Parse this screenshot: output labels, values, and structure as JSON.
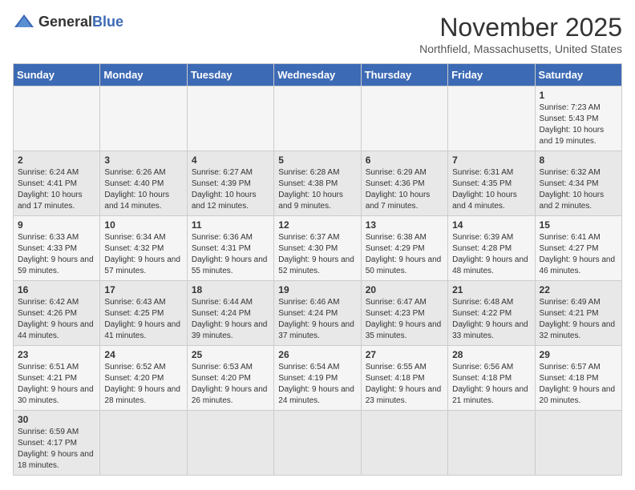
{
  "header": {
    "logo_general": "General",
    "logo_blue": "Blue",
    "month_year": "November 2025",
    "location": "Northfield, Massachusetts, United States"
  },
  "weekdays": [
    "Sunday",
    "Monday",
    "Tuesday",
    "Wednesday",
    "Thursday",
    "Friday",
    "Saturday"
  ],
  "weeks": [
    [
      {
        "day": "",
        "info": ""
      },
      {
        "day": "",
        "info": ""
      },
      {
        "day": "",
        "info": ""
      },
      {
        "day": "",
        "info": ""
      },
      {
        "day": "",
        "info": ""
      },
      {
        "day": "",
        "info": ""
      },
      {
        "day": "1",
        "info": "Sunrise: 7:23 AM\nSunset: 5:43 PM\nDaylight: 10 hours and 19 minutes."
      }
    ],
    [
      {
        "day": "2",
        "info": "Sunrise: 6:24 AM\nSunset: 4:41 PM\nDaylight: 10 hours and 17 minutes."
      },
      {
        "day": "3",
        "info": "Sunrise: 6:26 AM\nSunset: 4:40 PM\nDaylight: 10 hours and 14 minutes."
      },
      {
        "day": "4",
        "info": "Sunrise: 6:27 AM\nSunset: 4:39 PM\nDaylight: 10 hours and 12 minutes."
      },
      {
        "day": "5",
        "info": "Sunrise: 6:28 AM\nSunset: 4:38 PM\nDaylight: 10 hours and 9 minutes."
      },
      {
        "day": "6",
        "info": "Sunrise: 6:29 AM\nSunset: 4:36 PM\nDaylight: 10 hours and 7 minutes."
      },
      {
        "day": "7",
        "info": "Sunrise: 6:31 AM\nSunset: 4:35 PM\nDaylight: 10 hours and 4 minutes."
      },
      {
        "day": "8",
        "info": "Sunrise: 6:32 AM\nSunset: 4:34 PM\nDaylight: 10 hours and 2 minutes."
      }
    ],
    [
      {
        "day": "9",
        "info": "Sunrise: 6:33 AM\nSunset: 4:33 PM\nDaylight: 9 hours and 59 minutes."
      },
      {
        "day": "10",
        "info": "Sunrise: 6:34 AM\nSunset: 4:32 PM\nDaylight: 9 hours and 57 minutes."
      },
      {
        "day": "11",
        "info": "Sunrise: 6:36 AM\nSunset: 4:31 PM\nDaylight: 9 hours and 55 minutes."
      },
      {
        "day": "12",
        "info": "Sunrise: 6:37 AM\nSunset: 4:30 PM\nDaylight: 9 hours and 52 minutes."
      },
      {
        "day": "13",
        "info": "Sunrise: 6:38 AM\nSunset: 4:29 PM\nDaylight: 9 hours and 50 minutes."
      },
      {
        "day": "14",
        "info": "Sunrise: 6:39 AM\nSunset: 4:28 PM\nDaylight: 9 hours and 48 minutes."
      },
      {
        "day": "15",
        "info": "Sunrise: 6:41 AM\nSunset: 4:27 PM\nDaylight: 9 hours and 46 minutes."
      }
    ],
    [
      {
        "day": "16",
        "info": "Sunrise: 6:42 AM\nSunset: 4:26 PM\nDaylight: 9 hours and 44 minutes."
      },
      {
        "day": "17",
        "info": "Sunrise: 6:43 AM\nSunset: 4:25 PM\nDaylight: 9 hours and 41 minutes."
      },
      {
        "day": "18",
        "info": "Sunrise: 6:44 AM\nSunset: 4:24 PM\nDaylight: 9 hours and 39 minutes."
      },
      {
        "day": "19",
        "info": "Sunrise: 6:46 AM\nSunset: 4:24 PM\nDaylight: 9 hours and 37 minutes."
      },
      {
        "day": "20",
        "info": "Sunrise: 6:47 AM\nSunset: 4:23 PM\nDaylight: 9 hours and 35 minutes."
      },
      {
        "day": "21",
        "info": "Sunrise: 6:48 AM\nSunset: 4:22 PM\nDaylight: 9 hours and 33 minutes."
      },
      {
        "day": "22",
        "info": "Sunrise: 6:49 AM\nSunset: 4:21 PM\nDaylight: 9 hours and 32 minutes."
      }
    ],
    [
      {
        "day": "23",
        "info": "Sunrise: 6:51 AM\nSunset: 4:21 PM\nDaylight: 9 hours and 30 minutes."
      },
      {
        "day": "24",
        "info": "Sunrise: 6:52 AM\nSunset: 4:20 PM\nDaylight: 9 hours and 28 minutes."
      },
      {
        "day": "25",
        "info": "Sunrise: 6:53 AM\nSunset: 4:20 PM\nDaylight: 9 hours and 26 minutes."
      },
      {
        "day": "26",
        "info": "Sunrise: 6:54 AM\nSunset: 4:19 PM\nDaylight: 9 hours and 24 minutes."
      },
      {
        "day": "27",
        "info": "Sunrise: 6:55 AM\nSunset: 4:18 PM\nDaylight: 9 hours and 23 minutes."
      },
      {
        "day": "28",
        "info": "Sunrise: 6:56 AM\nSunset: 4:18 PM\nDaylight: 9 hours and 21 minutes."
      },
      {
        "day": "29",
        "info": "Sunrise: 6:57 AM\nSunset: 4:18 PM\nDaylight: 9 hours and 20 minutes."
      }
    ],
    [
      {
        "day": "30",
        "info": "Sunrise: 6:59 AM\nSunset: 4:17 PM\nDaylight: 9 hours and 18 minutes."
      },
      {
        "day": "",
        "info": ""
      },
      {
        "day": "",
        "info": ""
      },
      {
        "day": "",
        "info": ""
      },
      {
        "day": "",
        "info": ""
      },
      {
        "day": "",
        "info": ""
      },
      {
        "day": "",
        "info": ""
      }
    ]
  ]
}
